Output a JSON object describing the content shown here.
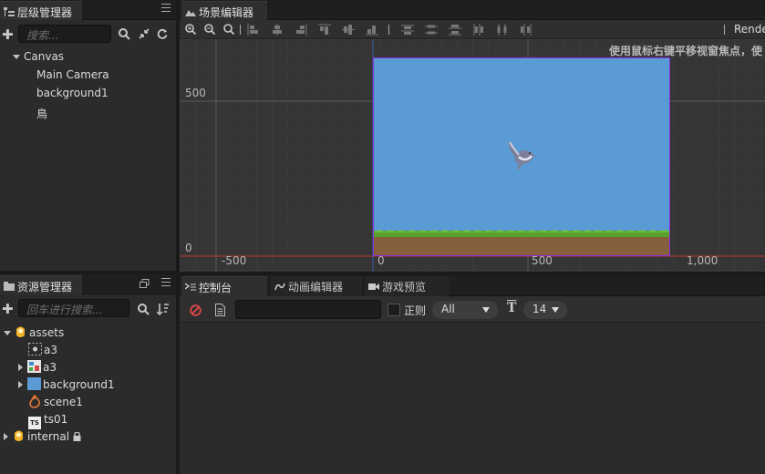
{
  "hierarchy": {
    "tab_label": "层级管理器",
    "search_placeholder": "搜索...",
    "items": [
      {
        "label": "Canvas"
      },
      {
        "label": "Main Camera"
      },
      {
        "label": "background1"
      },
      {
        "label": "鳥"
      }
    ]
  },
  "scene": {
    "tab_label": "场景编辑器",
    "hint": "使用鼠标右键平移视窗焦点，使",
    "render_label": "Render",
    "axis_y": [
      "500",
      "0"
    ],
    "axis_x": [
      "-500",
      "0",
      "500",
      "1,000"
    ]
  },
  "assets": {
    "tab_label": "资源管理器",
    "search_placeholder": "回车进行搜索...",
    "items": [
      {
        "label": "assets"
      },
      {
        "label": "a3"
      },
      {
        "label": "a3"
      },
      {
        "label": "background1"
      },
      {
        "label": "scene1"
      },
      {
        "label": "ts01"
      },
      {
        "label": "internal"
      }
    ],
    "ts_badge": "TS"
  },
  "console": {
    "tabs": [
      {
        "label": "控制台"
      },
      {
        "label": "动画编辑器"
      },
      {
        "label": "游戏预览"
      }
    ],
    "regex_label": "正则",
    "filter_value": "All",
    "font_size_value": "14",
    "font_icon_glyph": "T"
  },
  "colors": {
    "sky": "#5b9bd5",
    "grass": "#5aa02c",
    "dirt": "#86603d",
    "canvas_border": "#8a2be2",
    "axis_red": "#c0392b"
  }
}
